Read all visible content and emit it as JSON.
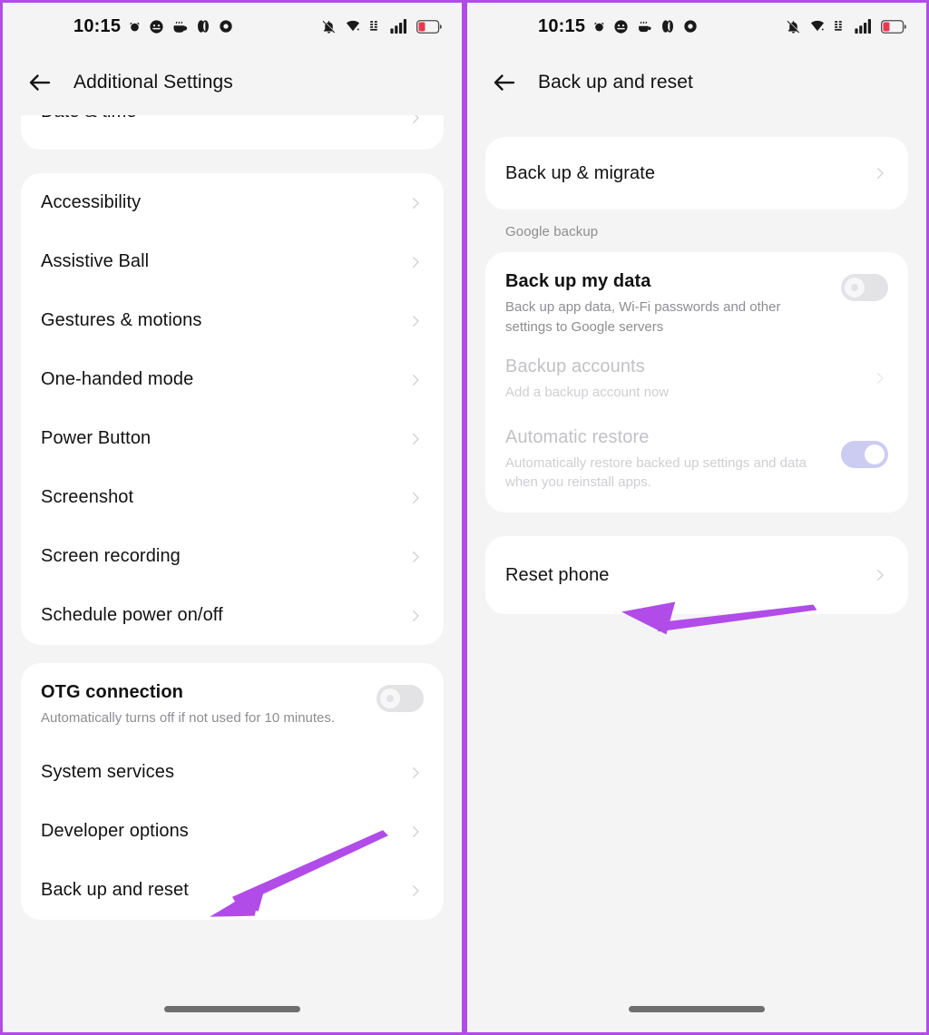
{
  "theme": {
    "accent_purple": "#b14ce8",
    "page_bg": "#f4f4f4",
    "card_bg": "#ffffff",
    "toggle_on_track": "#ccccf2",
    "toggle_off_track": "#e3e3e5",
    "battery_red": "#e8384f"
  },
  "left_phone": {
    "statusbar": {
      "time": "10:15",
      "left_icons": [
        "alarm-icon",
        "smiley-icon",
        "coffee-icon",
        "contrast-icon",
        "record-icon"
      ],
      "right_icons": [
        "mute-bell-icon",
        "wifi-icon",
        "vpn-icon",
        "signal-bars-icon",
        "battery-low-icon"
      ]
    },
    "appbar": {
      "back_label": "back-arrow",
      "title": "Additional Settings"
    },
    "card_clipped": {
      "items": [
        {
          "title": "Date & time",
          "chevron": true
        }
      ]
    },
    "card_main": {
      "items": [
        {
          "title": "Accessibility"
        },
        {
          "title": "Assistive Ball"
        },
        {
          "title": "Gestures & motions"
        },
        {
          "title": "One-handed mode"
        },
        {
          "title": "Power Button"
        },
        {
          "title": "Screenshot"
        },
        {
          "title": "Screen recording"
        },
        {
          "title": "Schedule power on/off"
        }
      ]
    },
    "card_bottom": {
      "otg": {
        "title": "OTG connection",
        "subtitle": "Automatically turns off if not used for 10 minutes.",
        "toggle_state": "off"
      },
      "items": [
        {
          "title": "System services"
        },
        {
          "title": "Developer options"
        },
        {
          "title": "Back up and reset"
        }
      ]
    },
    "annotation": {
      "name": "arrow-pointing-to-back-up-and-reset",
      "color": "#b14ce8"
    }
  },
  "right_phone": {
    "statusbar": {
      "time": "10:15",
      "left_icons": [
        "alarm-icon",
        "smiley-icon",
        "coffee-icon",
        "contrast-icon",
        "record-icon"
      ],
      "right_icons": [
        "mute-bell-icon",
        "wifi-icon",
        "vpn-icon",
        "signal-bars-icon",
        "battery-low-icon"
      ]
    },
    "appbar": {
      "back_label": "back-arrow",
      "title": "Back up and reset"
    },
    "card_migrate": {
      "items": [
        {
          "title": "Back up & migrate"
        }
      ]
    },
    "section_label": "Google backup",
    "card_google": {
      "backup_my_data": {
        "title": "Back up my data",
        "subtitle": "Back up app data, Wi-Fi passwords and other settings to Google servers",
        "toggle_state": "off"
      },
      "backup_accounts": {
        "title": "Backup accounts",
        "subtitle": "Add a backup account now",
        "disabled": true
      },
      "automatic_restore": {
        "title": "Automatic restore",
        "subtitle": "Automatically restore backed up settings and data when you reinstall apps.",
        "toggle_state": "on",
        "disabled": true
      }
    },
    "card_reset": {
      "items": [
        {
          "title": "Reset phone"
        }
      ]
    },
    "annotation": {
      "name": "arrow-pointing-to-reset-phone",
      "color": "#b14ce8"
    }
  }
}
